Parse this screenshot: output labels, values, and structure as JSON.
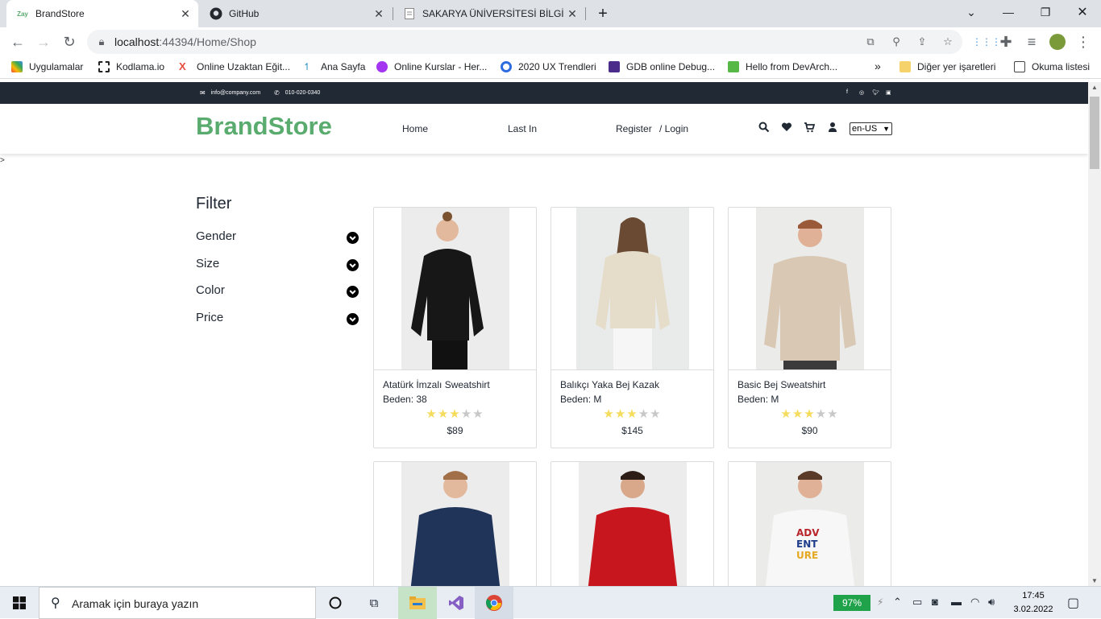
{
  "browser": {
    "tabs": [
      {
        "title": "BrandStore",
        "favicon": "Zay"
      },
      {
        "title": "GitHub"
      },
      {
        "title": "SAKARYA ÜNİVERSİTESİ BİLGİ SİS"
      }
    ],
    "url_host": "localhost",
    "url_rest": ":44394/Home/Shop",
    "bookmarks": [
      "Uygulamalar",
      "Kodlama.io",
      "Online Uzaktan Eğit...",
      "Ana Sayfa",
      "Online Kurslar - Her...",
      "2020 UX Trendleri",
      "GDB online Debug...",
      "Hello from DevArch..."
    ],
    "bookmarks_more": "»",
    "other_bookmarks": "Diğer yer işaretleri",
    "reading_list": "Okuma listesi"
  },
  "site": {
    "email": "info@company.com",
    "phone": "010-020-0340",
    "brand": "BrandStore",
    "nav": {
      "home": "Home",
      "last_in": "Last In",
      "register": "Register",
      "login": "/ Login"
    },
    "language": "en-US",
    "stray_text": ">",
    "accent_color": "#59ab6e",
    "topbar_color": "#212934"
  },
  "filter": {
    "title": "Filter",
    "items": [
      "Gender",
      "Size",
      "Color",
      "Price"
    ]
  },
  "products": [
    {
      "name": "Atatürk İmzalı Sweatshirt",
      "size": "Beden: 38",
      "rating": 3,
      "price": "$89"
    },
    {
      "name": "Balıkçı Yaka Bej Kazak",
      "size": "Beden: M",
      "rating": 3,
      "price": "$145"
    },
    {
      "name": "Basic Bej Sweatshirt",
      "size": "Beden: M",
      "rating": 3,
      "price": "$90"
    },
    {
      "name": "",
      "size": "",
      "rating": 0,
      "price": ""
    },
    {
      "name": "",
      "size": "",
      "rating": 0,
      "price": ""
    },
    {
      "name": "",
      "size": "",
      "rating": 0,
      "price": ""
    }
  ],
  "taskbar": {
    "search_placeholder": "Aramak için buraya yazın",
    "battery": "97%",
    "time": "17:45",
    "date": "3.02.2022"
  }
}
